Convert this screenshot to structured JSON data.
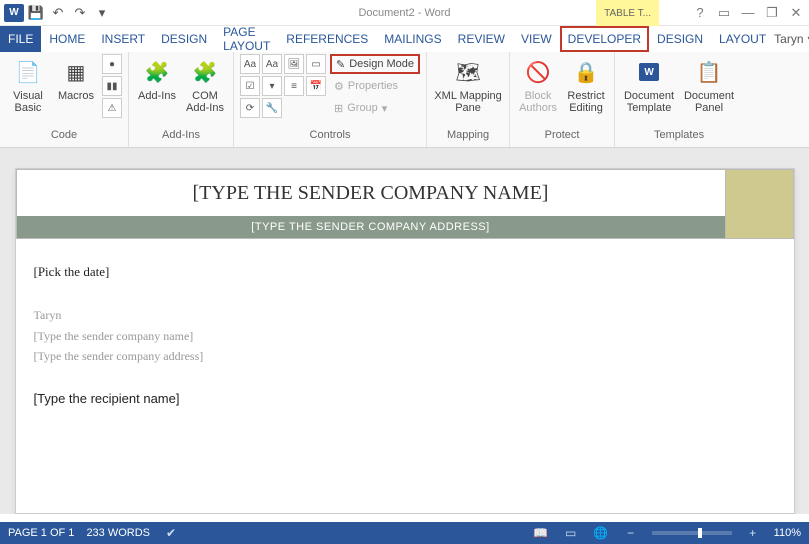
{
  "titlebar": {
    "doc_title": "Document2 - Word",
    "context_tab": "TABLE T...",
    "qat_icons": [
      "word",
      "save",
      "undo",
      "redo",
      "customize"
    ],
    "help_icon": "?"
  },
  "tabs": {
    "items": [
      {
        "label": "FILE",
        "kind": "file"
      },
      {
        "label": "HOME"
      },
      {
        "label": "INSERT"
      },
      {
        "label": "DESIGN"
      },
      {
        "label": "PAGE LAYOUT"
      },
      {
        "label": "REFERENCES"
      },
      {
        "label": "MAILINGS"
      },
      {
        "label": "REVIEW"
      },
      {
        "label": "VIEW"
      },
      {
        "label": "DEVELOPER",
        "highlight": true
      },
      {
        "label": "DESIGN"
      },
      {
        "label": "LAYOUT"
      }
    ],
    "user_name": "Taryn"
  },
  "ribbon": {
    "groups": {
      "code": {
        "label": "Code",
        "visual_basic": "Visual\nBasic",
        "macros": "Macros"
      },
      "addins": {
        "label": "Add-Ins",
        "addins": "Add-Ins",
        "com": "COM\nAdd-Ins"
      },
      "controls": {
        "label": "Controls",
        "design_mode": "Design Mode",
        "properties": "Properties",
        "group": "Group"
      },
      "mapping": {
        "label": "Mapping",
        "xml_mapping": "XML Mapping\nPane"
      },
      "protect": {
        "label": "Protect",
        "block_authors": "Block\nAuthors",
        "restrict": "Restrict\nEditing"
      },
      "templates": {
        "label": "Templates",
        "doc_template": "Document\nTemplate",
        "doc_panel": "Document\nPanel"
      }
    }
  },
  "document": {
    "sender_name_ph": "[TYPE THE SENDER COMPANY NAME]",
    "sender_addr_ph": "[TYPE THE SENDER COMPANY ADDRESS]",
    "date_ph": "[Pick the date]",
    "signed": "Taryn",
    "sender_name_small": "[Type the sender company name]",
    "sender_addr_small": "[Type the sender company address]",
    "recipient": "[Type the recipient name]"
  },
  "statusbar": {
    "page": "PAGE 1 OF 1",
    "words": "233 WORDS",
    "zoom_minus": "−",
    "zoom_plus": "+",
    "zoom_pct": "110%"
  }
}
